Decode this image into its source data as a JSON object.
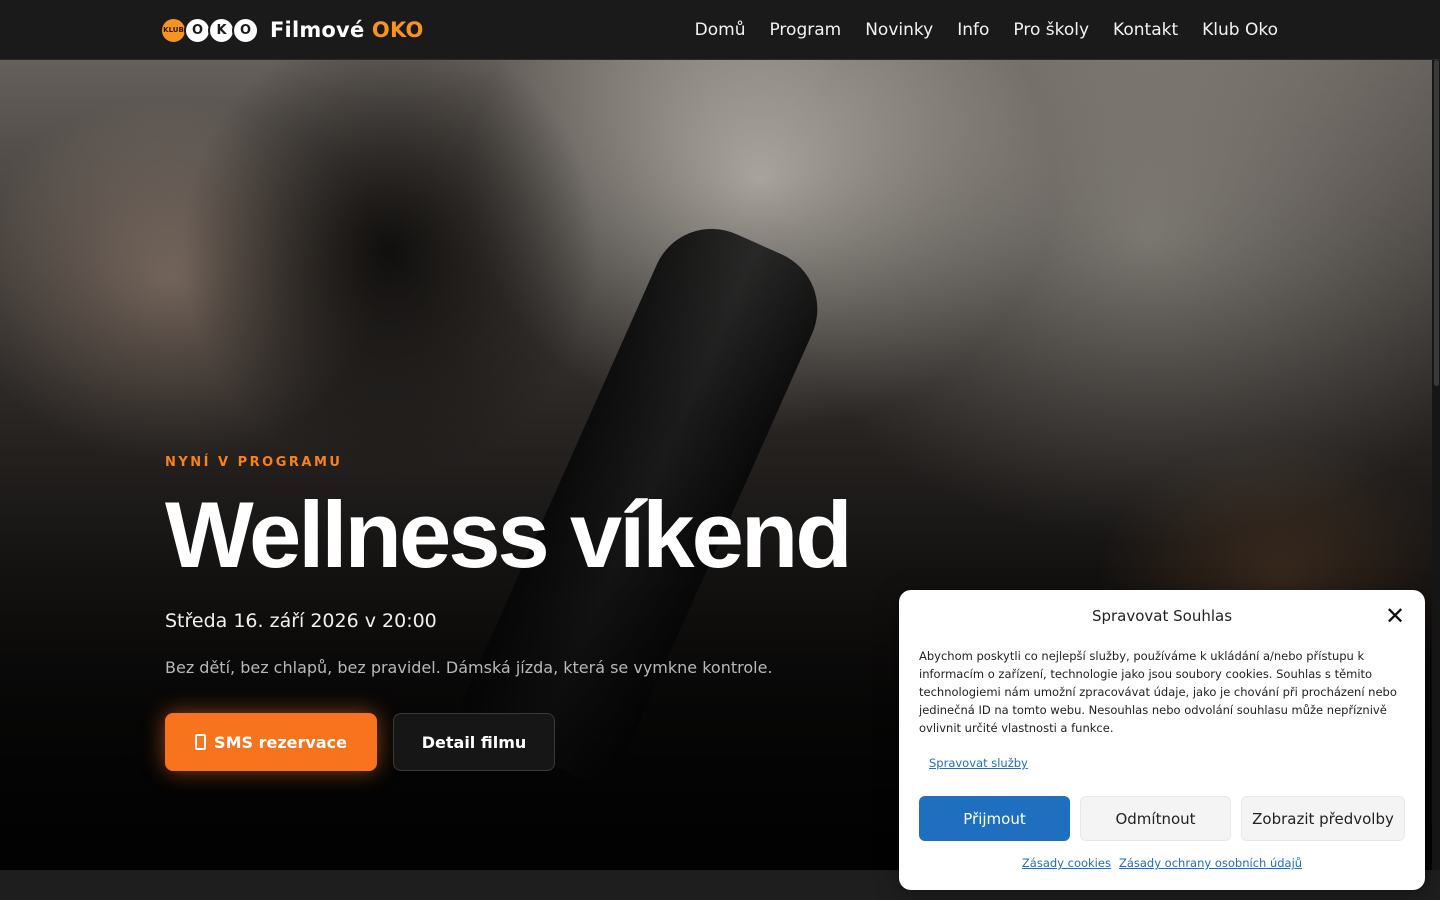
{
  "header": {
    "logo": {
      "badge": "KLUB",
      "letters": [
        "O",
        "K",
        "O"
      ],
      "title_main": "Filmové",
      "title_accent": "OKO"
    },
    "nav": [
      "Domů",
      "Program",
      "Novinky",
      "Info",
      "Pro školy",
      "Kontakt",
      "Klub Oko"
    ]
  },
  "hero": {
    "eyebrow": "NYNÍ V PROGRAMU",
    "title": "Wellness víkend",
    "date": "Středa 16. září 2026 v 20:00",
    "description": "Bez dětí, bez chlapů, bez pravidel. Dámská jízda, která se vymkne kontrole.",
    "sms_button": "SMS rezervace",
    "detail_button": "Detail filmu"
  },
  "cookie": {
    "title": "Spravovat Souhlas",
    "close": "✕",
    "body": "Abychom poskytli co nejlepší služby, používáme k ukládání a/nebo přístupu k informacím o zařízení, technologie jako jsou soubory cookies. Souhlas s těmito technologiemi nám umožní zpracovávat údaje, jako je chování při procházení nebo jedinečná ID na tomto webu. Nesouhlas nebo odvolání souhlasu může nepříznivě ovlivnit určité vlastnosti a funkce.",
    "manage_link": "Spravovat služby",
    "accept": "Přijmout",
    "deny": "Odmítnout",
    "preferences": "Zobrazit předvolby",
    "links": [
      "Zásady cookies",
      "Zásady ochrany osobních údajů"
    ]
  },
  "colors": {
    "accent_orange": "#f7731e",
    "logo_orange": "#f7931e",
    "cookie_blue": "#1e6fbf",
    "header_bg": "#1a1a1a"
  },
  "icons": [
    "phone-icon",
    "close-icon"
  ]
}
